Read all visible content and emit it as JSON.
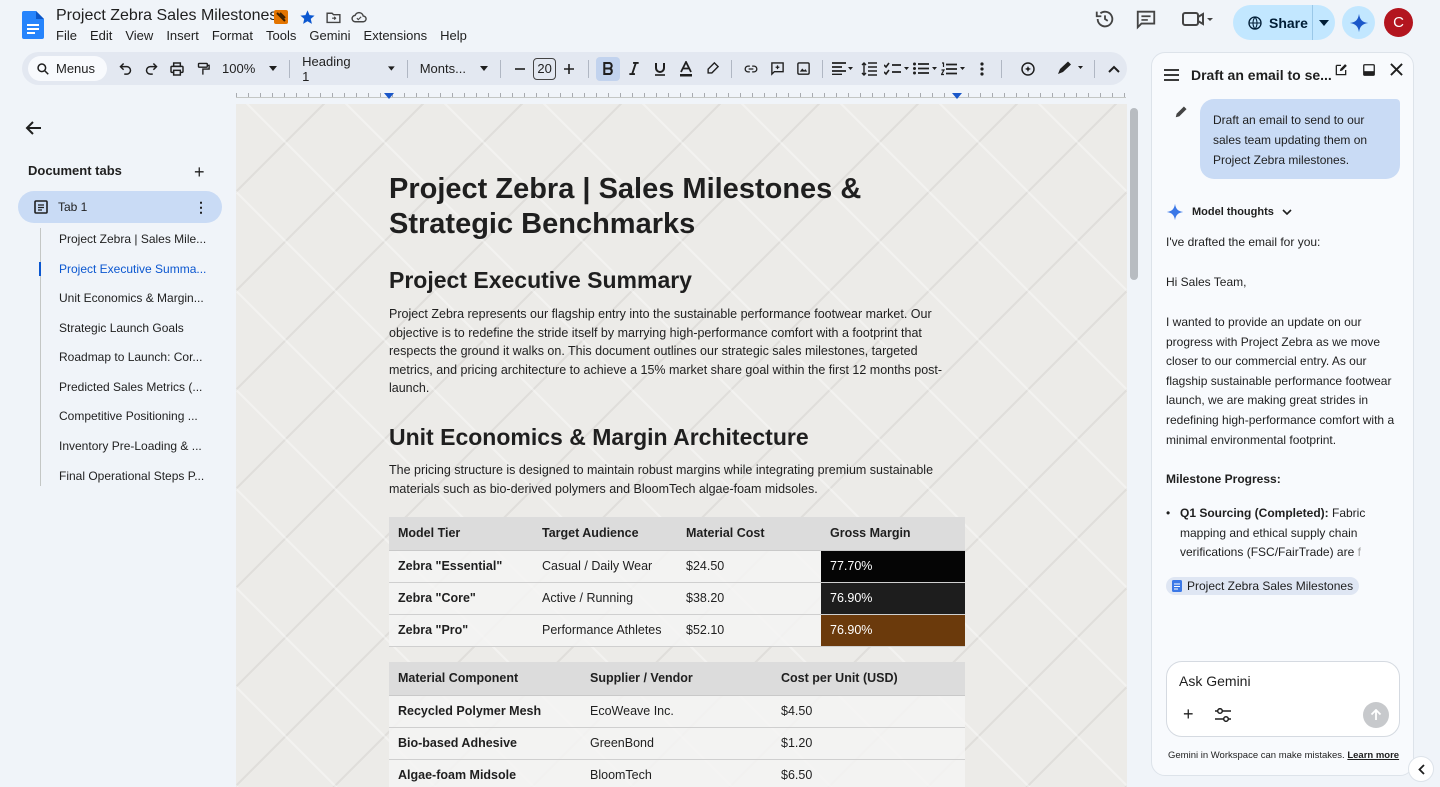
{
  "app": {
    "doc_title": "Project Zebra Sales Milestones",
    "menu": [
      "File",
      "Edit",
      "View",
      "Insert",
      "Format",
      "Tools",
      "Gemini",
      "Extensions",
      "Help"
    ],
    "share_label": "Share",
    "avatar_letter": "C",
    "colors": {
      "accent": "#0b57d0",
      "share_bg": "#c2e7ff",
      "avatar_bg": "#b3151f"
    }
  },
  "toolbar": {
    "menus_label": "Menus",
    "zoom": "100%",
    "style": "Heading 1",
    "font": "Monts...",
    "font_size": "20"
  },
  "outline": {
    "header": "Document tabs",
    "tab_label": "Tab 1",
    "items": [
      "Project Zebra | Sales Mile...",
      "Project Executive Summa...",
      "Unit Economics & Margin...",
      "Strategic Launch Goals",
      "Roadmap to Launch: Cor...",
      "Predicted Sales Metrics (...",
      "Competitive Positioning ...",
      "Inventory Pre-Loading & ...",
      "Final Operational Steps P..."
    ]
  },
  "document": {
    "title": "Project Zebra | Sales Milestones & Strategic Benchmarks",
    "exec_heading": "Project Executive Summary",
    "exec_body": "Project Zebra represents our flagship entry into the sustainable performance footwear market. Our objective is to redefine the stride itself by marrying high-performance comfort with a footprint that respects the ground it walks on. This document outlines our strategic sales milestones, targeted metrics, and pricing architecture to achieve a 15% market share goal within the first 12 months post-launch.",
    "unit_heading": "Unit Economics & Margin Architecture",
    "unit_body": "The pricing structure is designed to maintain robust margins while integrating premium sustainable materials such as bio-derived polymers and BloomTech algae-foam midsoles.",
    "tier_table": {
      "headers": [
        "Model Tier",
        "Target Audience",
        "Material Cost",
        "Gross Margin"
      ],
      "rows": [
        [
          "Zebra \"Essential\"",
          "Casual / Daily Wear",
          "$24.50",
          "77.70%"
        ],
        [
          "Zebra \"Core\"",
          "Active / Running",
          "$38.20",
          "76.90%"
        ],
        [
          "Zebra \"Pro\"",
          "Performance Athletes",
          "$52.10",
          "76.90%"
        ]
      ]
    },
    "material_table": {
      "headers": [
        "Material Component",
        "Supplier / Vendor",
        "Cost per Unit (USD)"
      ],
      "rows": [
        [
          "Recycled Polymer Mesh",
          "EcoWeave Inc.",
          "$4.50"
        ],
        [
          "Bio-based Adhesive",
          "GreenBond",
          "$1.20"
        ],
        [
          "Algae-foam Midsole",
          "BloomTech",
          "$6.50"
        ]
      ]
    }
  },
  "gemini": {
    "panel_title": "Draft an email to se...",
    "user_prompt": "Draft an email to send to our sales team updating them on Project Zebra milestones.",
    "model_thoughts": "Model thoughts",
    "intro": "I've drafted the email for you:",
    "greeting": "Hi Sales Team,",
    "para1": "I wanted to provide an update on our progress with Project Zebra as we move closer to our commercial entry. As our flagship sustainable performance footwear launch, we are making great strides in redefining high-performance comfort with a minimal environmental footprint.",
    "milestone_heading": "Milestone Progress:",
    "bullet_bold": "Q1 Sourcing (Completed):",
    "bullet_text": " Fabric mapping and ethical supply chain verifications (FSC/FairTrade) are ",
    "bullet_fade": "f",
    "source_chip": "Project Zebra Sales Milestones",
    "ask_placeholder": "Ask Gemini",
    "disclaimer": "Gemini in Workspace can make mistakes.",
    "learn_more": "Learn more"
  }
}
